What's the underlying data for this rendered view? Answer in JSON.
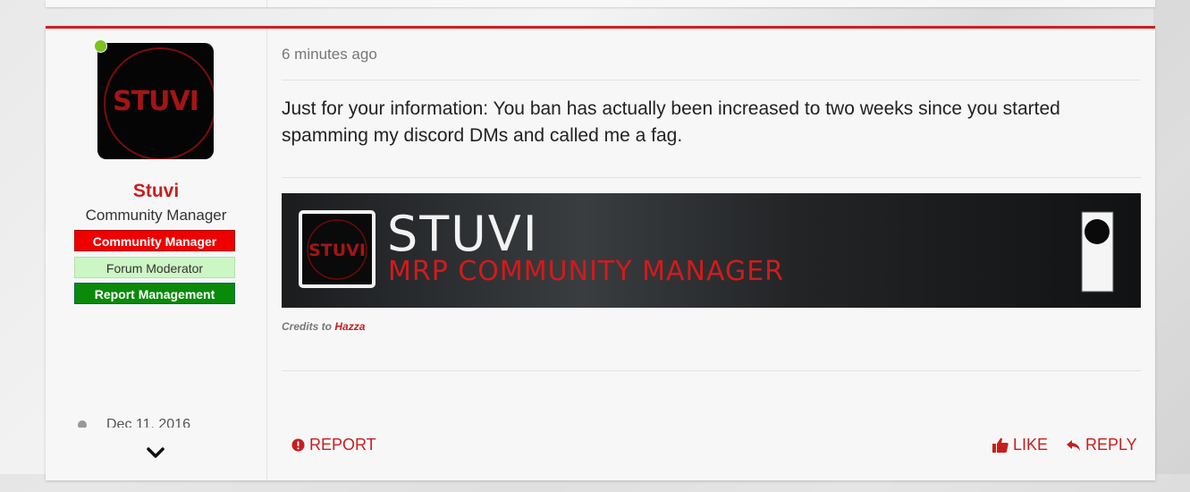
{
  "post": {
    "author": {
      "name": "Stuvi",
      "title": "Community Manager",
      "badges": [
        "Community Manager",
        "Forum Moderator",
        "Report Management"
      ],
      "joined": "Dec 11, 2016",
      "avatar_text": "STUVI",
      "online": true
    },
    "timestamp": "6 minutes ago",
    "message": "Just for your information: You ban has actually been increased to two weeks since you started spamming my discord DMs and called me a fag.",
    "signature": {
      "name": "STUVI",
      "role": "MRP COMMUNITY MANAGER",
      "logo_text": "STUVI",
      "credits_prefix": "Credits to",
      "credits_name": "Hazza"
    },
    "actions": {
      "report": "REPORT",
      "like": "LIKE",
      "reply": "REPLY"
    }
  },
  "colors": {
    "accent": "#c81e1e",
    "online": "#7dc21e",
    "badge_cm": "#e00000",
    "badge_fm": "#cdf6c5",
    "badge_rm": "#0a8a0a"
  },
  "icons": {
    "report": "exclamation-circle-icon",
    "like": "thumbs-up-icon",
    "reply": "reply-arrow-icon",
    "expand": "chevron-down-icon",
    "joined": "user-icon"
  }
}
